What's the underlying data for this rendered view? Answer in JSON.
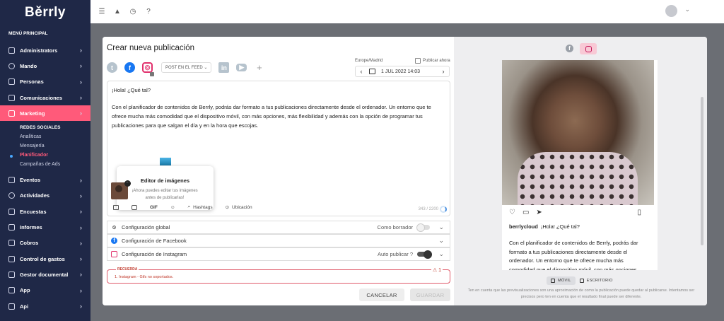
{
  "brand": {
    "logo": "Běrrly"
  },
  "sidebar": {
    "title": "MENÚ PRINCIPAL",
    "items": [
      {
        "label": "Administrators"
      },
      {
        "label": "Mando"
      },
      {
        "label": "Personas"
      },
      {
        "label": "Comunicaciones"
      },
      {
        "label": "Marketing"
      }
    ],
    "sub_title": "REDES SOCIALES",
    "sub_items": [
      {
        "label": "Analíticas"
      },
      {
        "label": "Mensajería"
      },
      {
        "label": "Planificador"
      },
      {
        "label": "Campañas de Ads"
      }
    ],
    "items2": [
      {
        "label": "Eventos"
      },
      {
        "label": "Actividades"
      },
      {
        "label": "Encuestas"
      },
      {
        "label": "Informes"
      },
      {
        "label": "Cobros"
      },
      {
        "label": "Control de gastos"
      },
      {
        "label": "Gestor documental"
      },
      {
        "label": "App"
      },
      {
        "label": "Api"
      }
    ]
  },
  "modal": {
    "title": "Crear nueva publicación",
    "post_type": "POST EN EL FEED ⌄",
    "timezone": "Europe/Madrid",
    "publish_now": "Publicar ahora",
    "date": "1 JUL 2022 14:03",
    "greeting": "¡Hola! ¿Qué tal?",
    "body": "Con el planificador de contenidos de Berrly, podrás dar formato a tus publicaciones directamente desde el ordenador. Un entorno que te ofrece mucha más comodidad que el dispositivo móvil, con más opciones, más flexibilidad y además con la opción de programar tus publicaciones para que salgan el día y en la hora que escojas.",
    "tooltip_title": "Editor de imágenes",
    "tooltip_body": "¡Ahora puedes editar tus imágenes antes de publicarlas!",
    "tools": {
      "gif": "GIF",
      "hashtags": "Hashtags",
      "location": "Ubicación"
    },
    "counter": "343 / 2200",
    "acc_global": "Configuración global",
    "acc_global_toggle": "Como borrador",
    "acc_facebook": "Configuración de Facebook",
    "acc_instagram": "Configuración de Instagram",
    "acc_instagram_toggle": "Auto publicar ?",
    "alert_title": "RECUERDA",
    "alert_body": "1. Instagram - Gifs no soportados.",
    "alert_count": "1",
    "cancel": "CANCELAR",
    "save": "GUARDAR"
  },
  "preview": {
    "username": "berrlycloud",
    "caption_greeting": "¡Hola! ¿Qué tal?",
    "caption": "Con el planificador de contenidos de Berrly, podrás dar formato a tus publicaciones directamente desde el ordenador. Un entorno que te ofrece mucha más comodidad que el dispositivo móvil, con más opciones,",
    "mode_mobile": "MÓVIL",
    "mode_desktop": "ESCRITORIO",
    "disclaimer": "Ten en cuenta que las previsualizaciones son una aproximación de como la publicación puede quedar al publicarse. Intentamos ser precisos pero ten en cuenta que el resultado final puede ser diferente."
  },
  "colors": {
    "sidebar": "#1f2847",
    "accent": "#ff5a7a",
    "facebook": "#1877f2",
    "instagram": "#e1306c"
  }
}
